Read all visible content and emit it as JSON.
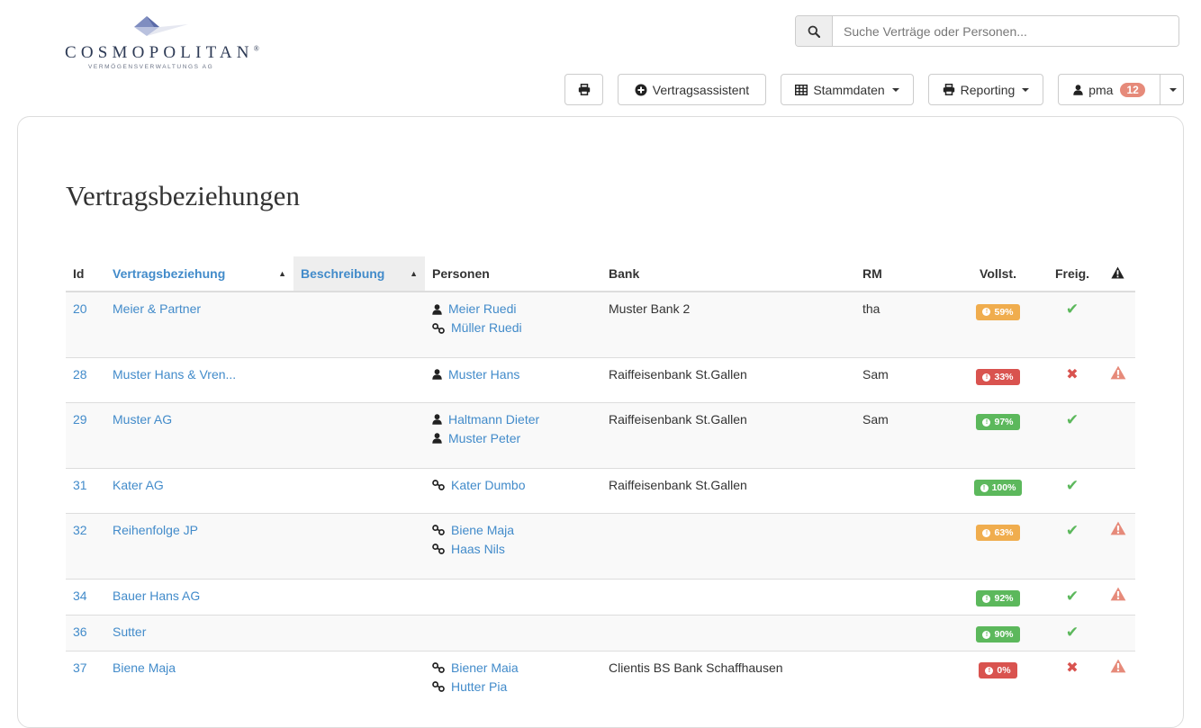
{
  "header": {
    "logo_name": "COSMOPOLITAN",
    "logo_reg": "®",
    "logo_sub": "VERMÖGENSVERWALTUNGS AG",
    "search_placeholder": "Suche Verträge oder Personen...",
    "toolbar": {
      "assistant_label": "Vertragsassistent",
      "masterdata_label": "Stammdaten",
      "reporting_label": "Reporting",
      "user_label": "pma",
      "user_badge": "12"
    }
  },
  "page": {
    "title": "Vertragsbeziehungen"
  },
  "colors": {
    "link": "#428bca",
    "success": "#5cb85c",
    "warning": "#f0ad4e",
    "danger": "#d9534f",
    "alert_icon": "#e68a7a"
  },
  "table": {
    "headers": {
      "id": "Id",
      "vertragsbeziehung": "Vertragsbeziehung",
      "beschreibung": "Beschreibung",
      "personen": "Personen",
      "bank": "Bank",
      "rm": "RM",
      "vollst": "Vollst.",
      "freig": "Freig."
    },
    "rows": [
      {
        "id": "20",
        "name": "Meier & Partner",
        "p1": "Meier Ruedi",
        "p1_icon": "user-icon",
        "p2": "Müller Ruedi",
        "p2_icon": "link-icon",
        "bank": "Muster Bank 2",
        "rm": "tha",
        "vollst": "59%",
        "vollst_status": "warning",
        "freig": "check",
        "alert": false
      },
      {
        "id": "28",
        "name": "Muster Hans & Vren...",
        "p1": "Muster Hans",
        "p1_icon": "user-icon",
        "p2": "",
        "p2_icon": "",
        "bank": "Raiffeisenbank St.Gallen",
        "rm": "Sam",
        "vollst": "33%",
        "vollst_status": "danger",
        "freig": "cross",
        "alert": true
      },
      {
        "id": "29",
        "name": "Muster AG",
        "p1": "Haltmann Dieter",
        "p1_icon": "user-icon",
        "p2": "Muster Peter",
        "p2_icon": "user-icon",
        "bank": "Raiffeisenbank St.Gallen",
        "rm": "Sam",
        "vollst": "97%",
        "vollst_status": "success",
        "freig": "check",
        "alert": false
      },
      {
        "id": "31",
        "name": "Kater AG",
        "p1": "Kater Dumbo",
        "p1_icon": "link-icon",
        "p2": "",
        "p2_icon": "",
        "bank": "Raiffeisenbank St.Gallen",
        "rm": "",
        "vollst": "100%",
        "vollst_status": "success",
        "freig": "check",
        "alert": false
      },
      {
        "id": "32",
        "name": "Reihenfolge JP",
        "p1": "Biene Maja",
        "p1_icon": "link-icon",
        "p2": "Haas Nils",
        "p2_icon": "link-icon",
        "bank": "",
        "rm": "",
        "vollst": "63%",
        "vollst_status": "warning",
        "freig": "check",
        "alert": true
      },
      {
        "id": "34",
        "name": "Bauer Hans AG",
        "p1": "",
        "p1_icon": "",
        "p2": "",
        "p2_icon": "",
        "bank": "",
        "rm": "",
        "vollst": "92%",
        "vollst_status": "success",
        "freig": "check",
        "alert": true
      },
      {
        "id": "36",
        "name": "Sutter",
        "p1": "",
        "p1_icon": "",
        "p2": "",
        "p2_icon": "",
        "bank": "",
        "rm": "",
        "vollst": "90%",
        "vollst_status": "success",
        "freig": "check",
        "alert": false
      },
      {
        "id": "37",
        "name": "Biene Maja",
        "p1": "Biener Maia",
        "p1_icon": "link-icon",
        "p2": "Hutter Pia",
        "p2_icon": "link-icon",
        "bank": "Clientis BS Bank Schaffhausen",
        "rm": "",
        "vollst": "0%",
        "vollst_status": "danger",
        "freig": "cross",
        "alert": true
      }
    ]
  }
}
